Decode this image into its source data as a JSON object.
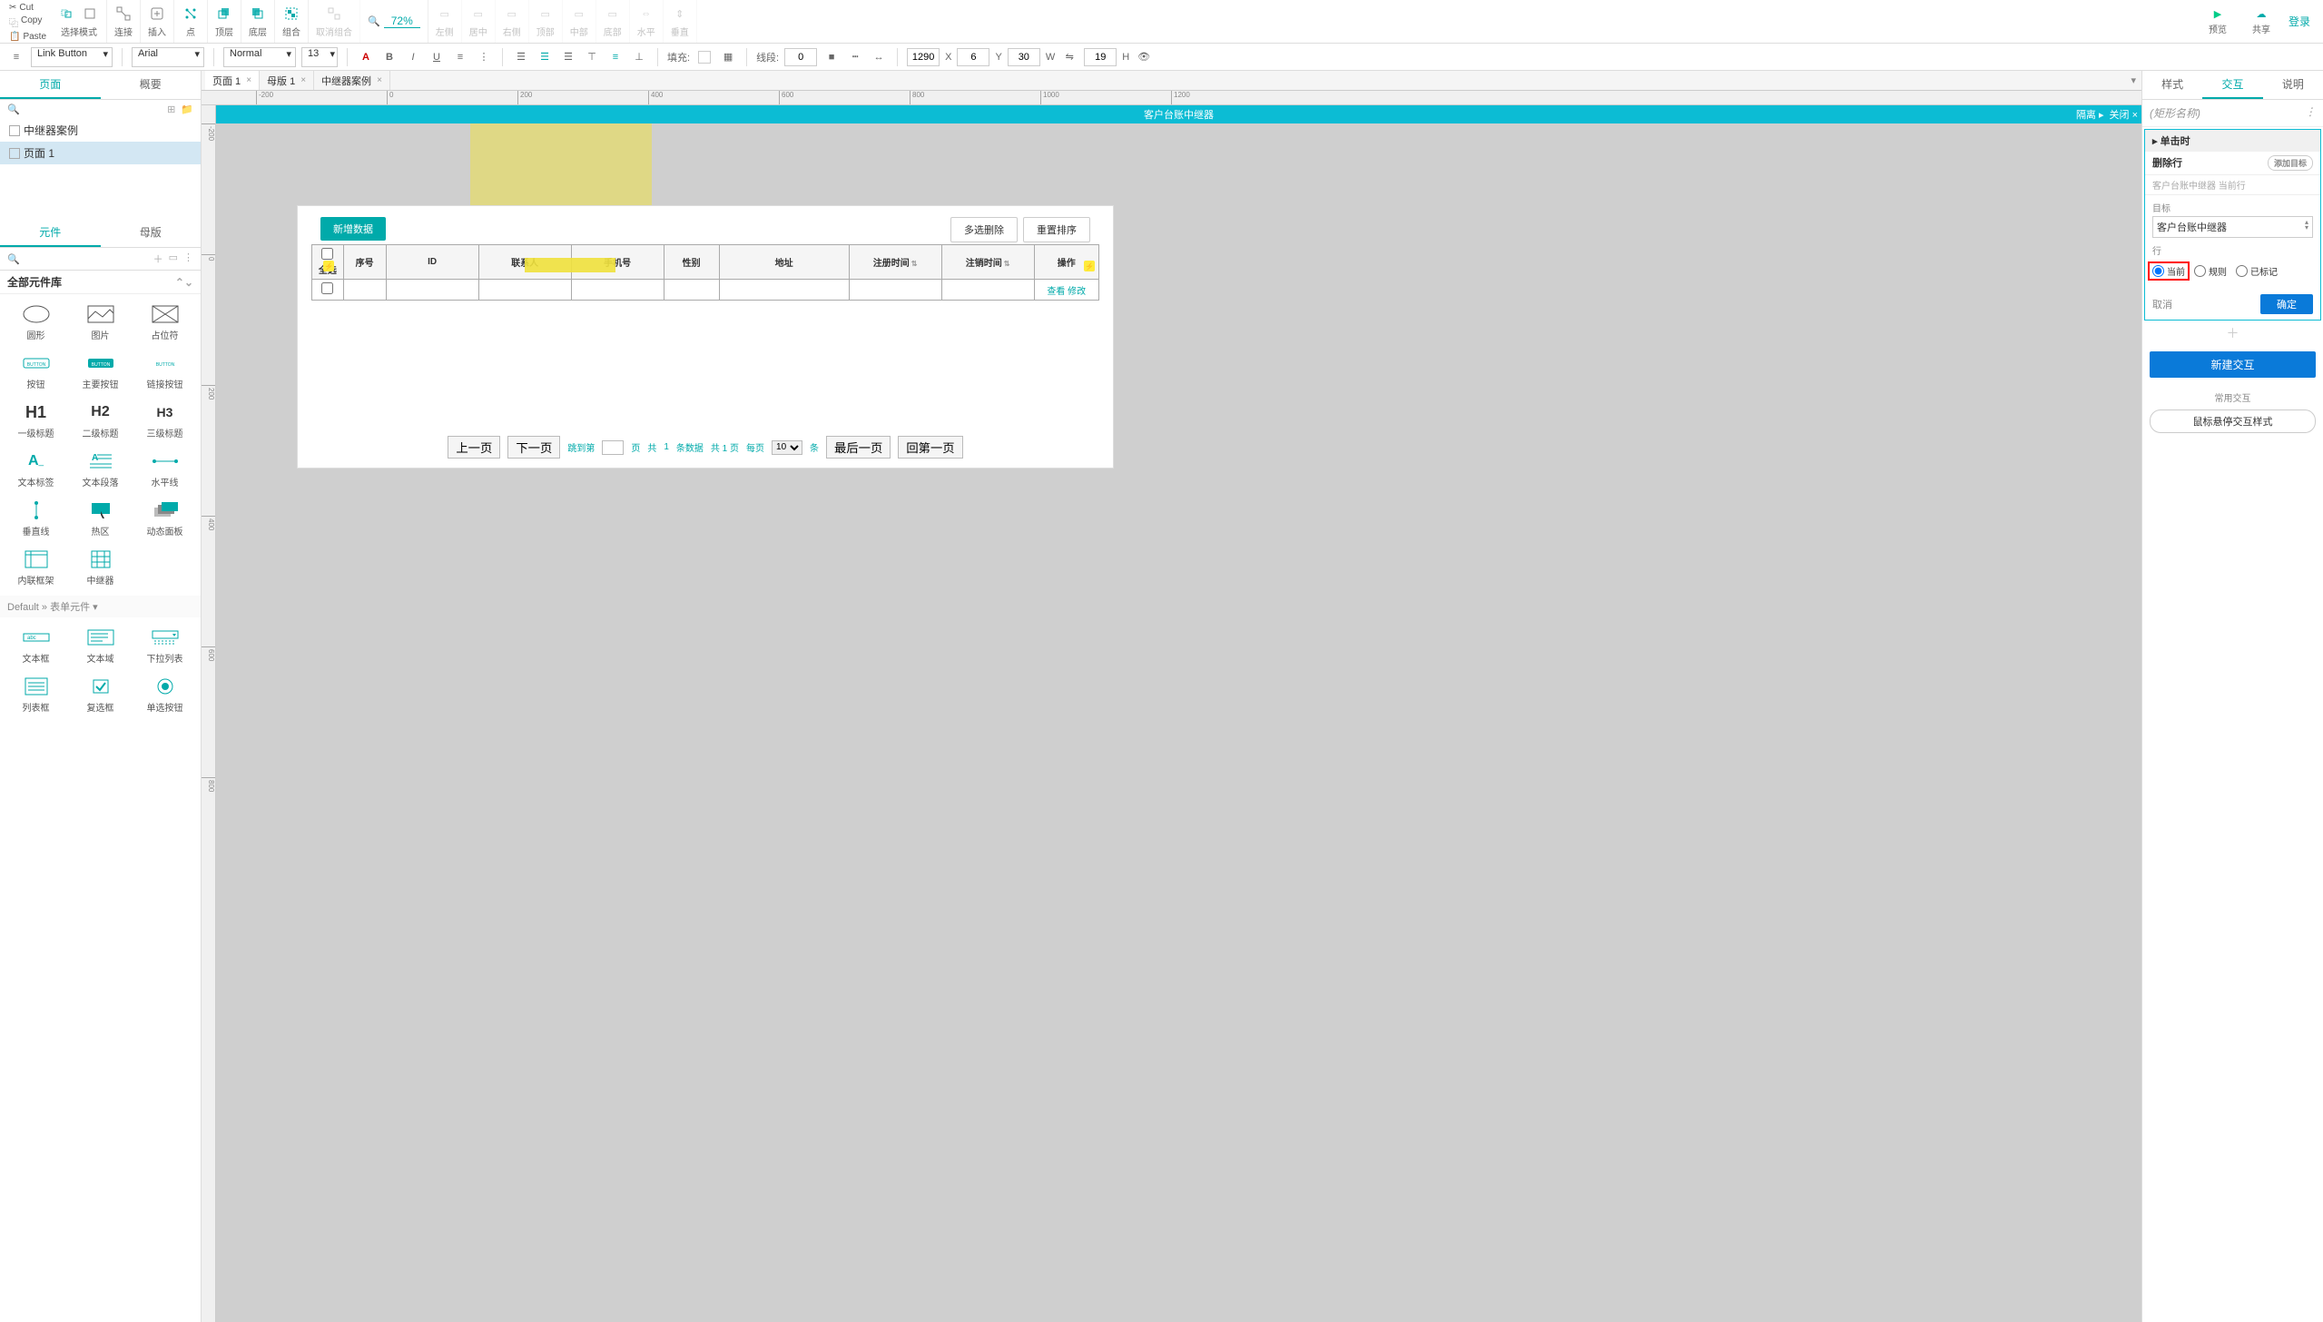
{
  "clipboard": {
    "cut": "Cut",
    "copy": "Copy",
    "paste": "Paste"
  },
  "toolbar": {
    "selectMode": "选择模式",
    "connect": "连接",
    "insert": "插入",
    "point": "点",
    "top": "顶层",
    "bottom": "底层",
    "group": "组合",
    "ungroup": "取消组合",
    "alignL": "左侧",
    "alignC": "居中",
    "alignR": "右侧",
    "alignT": "顶部",
    "alignM": "中部",
    "alignB": "底部",
    "distH": "水平",
    "distV": "垂直",
    "zoom": "72%",
    "preview": "预览",
    "share": "共享",
    "login": "登录"
  },
  "format": {
    "widgetStyle": "Link Button",
    "font": "Arial",
    "weight": "Normal",
    "size": "13",
    "fill": "填充:",
    "line": "线段:",
    "lineW": "0",
    "x": "1290",
    "y": "6",
    "w": "30",
    "h": "19",
    "xL": "X",
    "yL": "Y",
    "wL": "W",
    "hL": "H"
  },
  "leftTabs": {
    "pages": "页面",
    "outline": "概要"
  },
  "pages": {
    "p1": "中继器案例",
    "p2": "页面 1"
  },
  "widgetTabs": {
    "widgets": "元件",
    "masters": "母版"
  },
  "widgetLib": "全部元件库",
  "widgets": {
    "ellipse": "圆形",
    "image": "图片",
    "placeholder": "占位符",
    "button": "按钮",
    "primaryBtn": "主要按钮",
    "linkBtn": "链接按钮",
    "h1": "一级标题",
    "h2": "二级标题",
    "h3": "三级标题",
    "label": "文本标签",
    "paragraph": "文本段落",
    "hline": "水平线",
    "vline": "垂直线",
    "hotspot": "热区",
    "dynpanel": "动态面板",
    "iframe": "内联框架",
    "repeater": "中继器",
    "textfield": "文本框",
    "textarea": "文本域",
    "droplist": "下拉列表",
    "listbox": "列表框",
    "checkbox": "复选框",
    "radio": "单选按钮"
  },
  "widgetIcons": {
    "h1t": "H1",
    "h2t": "H2",
    "h3t": "H3",
    "btnt": "BUTTON"
  },
  "formCat": "Default » 表单元件 ▾",
  "docTabs": {
    "t1": "页面 1",
    "t2": "母版 1",
    "t3": "中继器案例"
  },
  "canvasTitle": {
    "center": "客户台账中继器",
    "isolate": "隔离 ▸",
    "close": "关闭 ×"
  },
  "page": {
    "newData": "新增数据",
    "multiDel": "多选删除",
    "resetSort": "重置排序",
    "cols": {
      "all": "全选",
      "seq": "序号",
      "id": "ID",
      "contact": "联系人",
      "mobile": "手机号",
      "gender": "性别",
      "address": "地址",
      "regTime": "注册时间",
      "cancelTime": "注销时间",
      "ops": "操作"
    },
    "view": "查看",
    "modify": "修改",
    "prev": "上一页",
    "next": "下一页",
    "jumpTo": "跳到第",
    "pageU": "页",
    "total1": "共",
    "total2": "1",
    "total3": "条数据",
    "total4": "共 1 页",
    "perPage": "每页",
    "perPageN": "10",
    "unit": "条",
    "last": "最后一页",
    "first": "回第一页"
  },
  "rightTabs": {
    "style": "样式",
    "interaction": "交互",
    "notes": "说明"
  },
  "rp": {
    "shapeName": "(矩形名称)",
    "onClick": "单击时",
    "deleteRow": "删除行",
    "addTarget": "添加目标",
    "desc": "客户台账中继器 当前行",
    "target": "目标",
    "targetVal": "客户台账中继器",
    "row": "行",
    "r1": "当前",
    "r2": "规则",
    "r3": "已标记",
    "cancel": "取消",
    "confirm": "确定",
    "newIx": "新建交互",
    "commonIx": "常用交互",
    "hoverStyle": "鼠标悬停交互样式"
  },
  "rulerH": [
    -200,
    0,
    200,
    400,
    600,
    800,
    1000,
    1200
  ],
  "rulerV": [
    -200,
    0,
    200,
    400,
    600,
    800
  ]
}
